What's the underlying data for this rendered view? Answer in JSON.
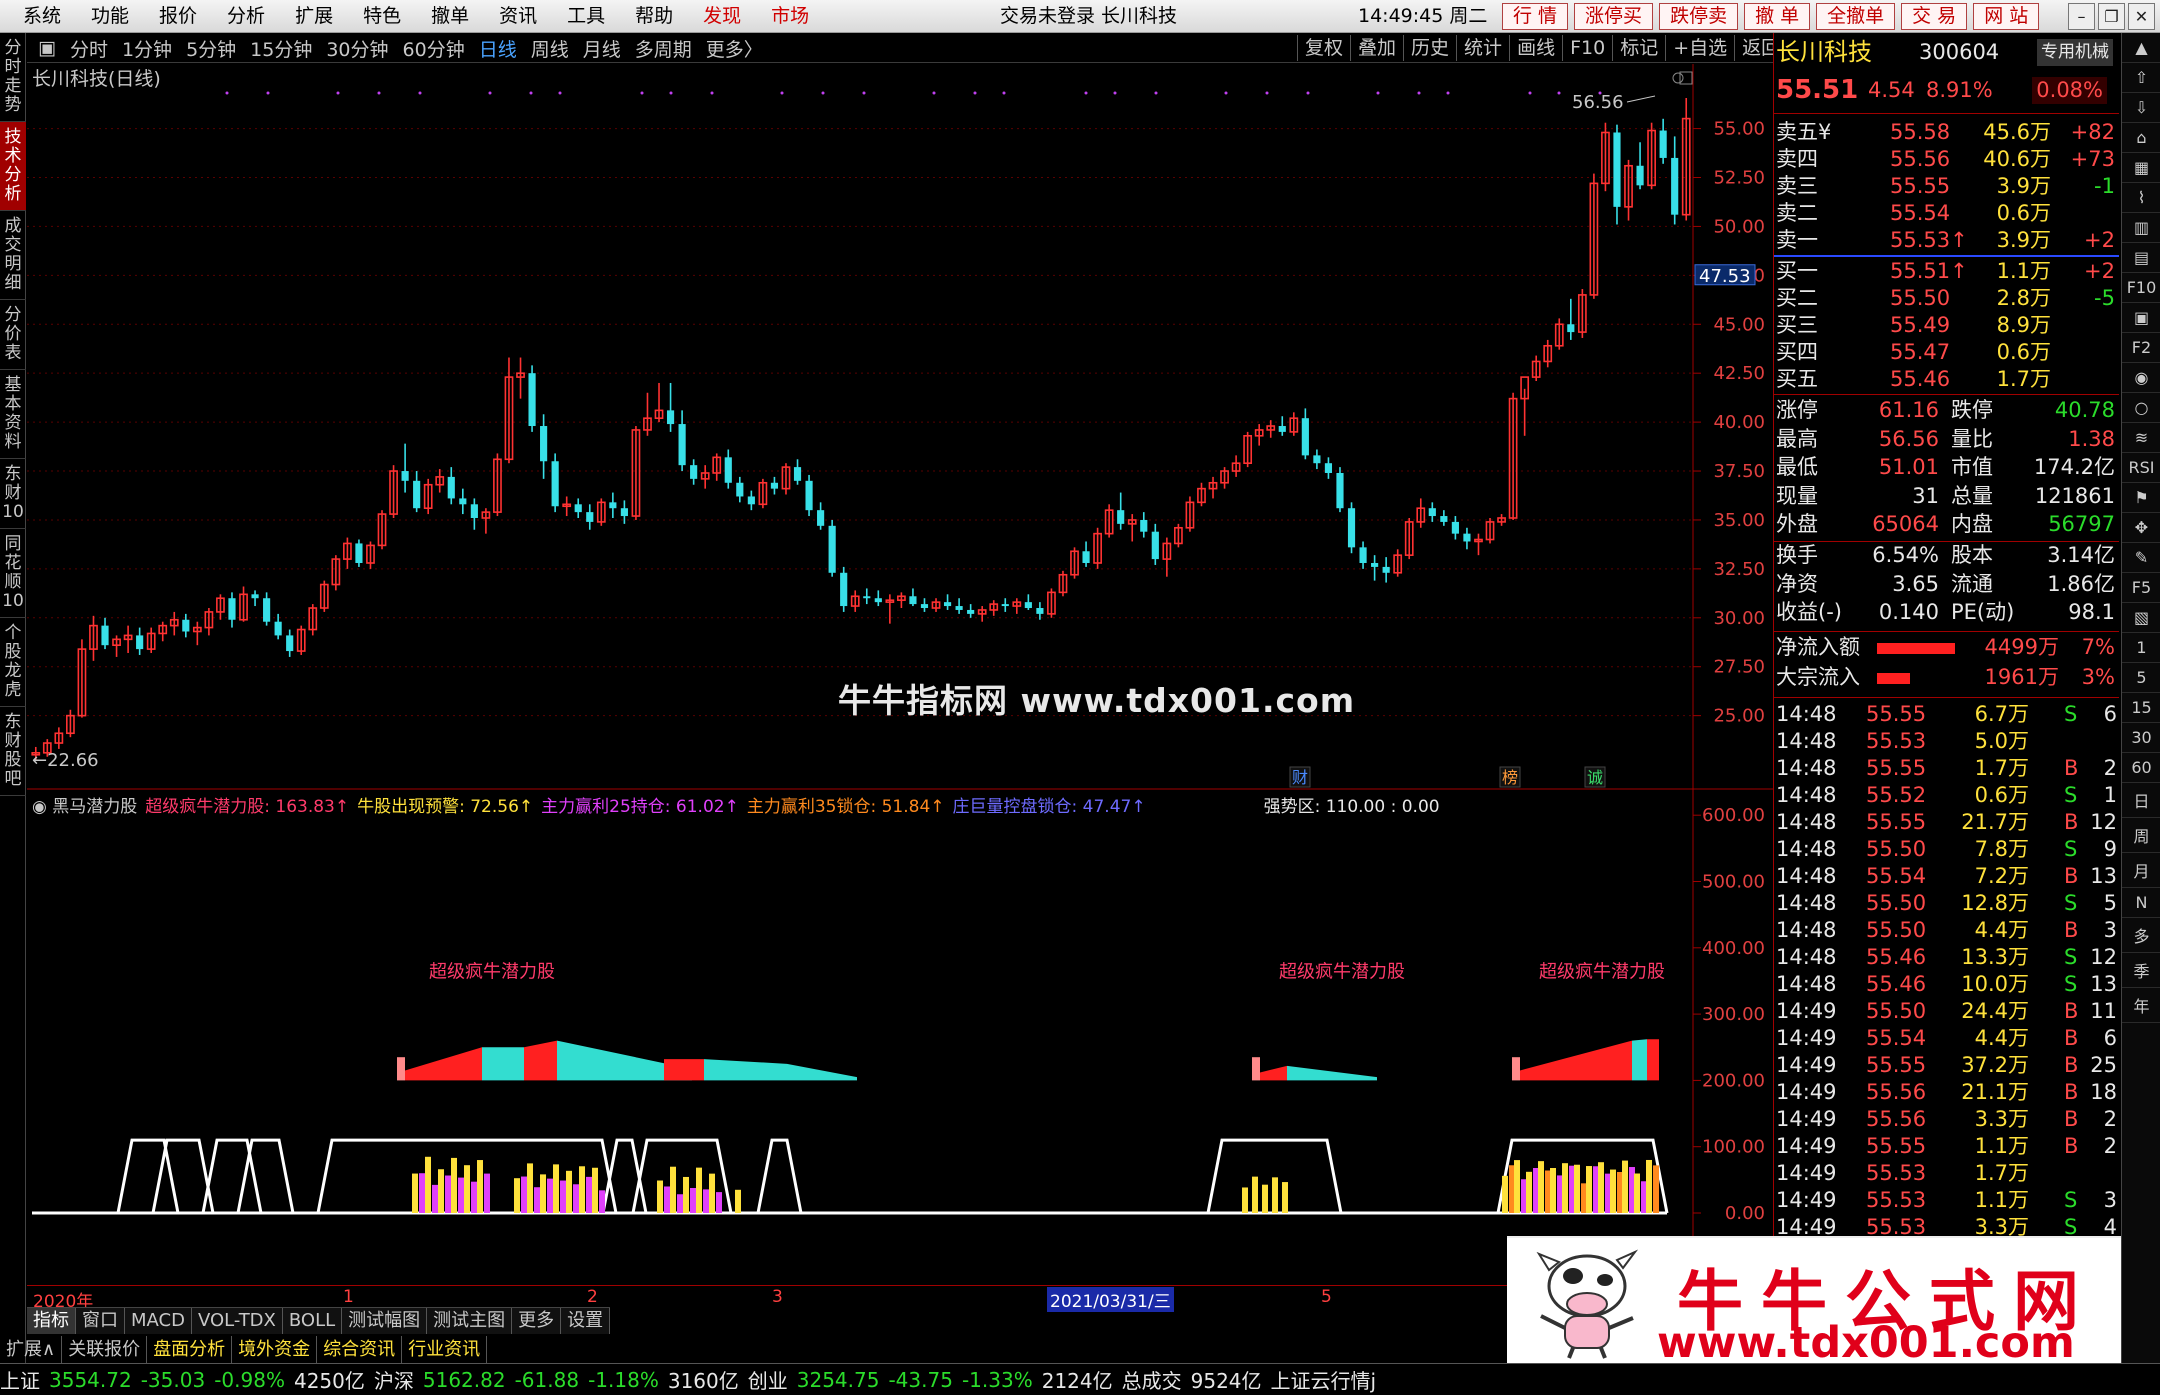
{
  "menubar": {
    "items": [
      "系统",
      "功能",
      "报价",
      "分析",
      "扩展",
      "特色",
      "撤单",
      "资讯",
      "工具",
      "帮助",
      "发现",
      "市场"
    ],
    "highlight": [
      "发现",
      "市场"
    ],
    "login_status": "交易未登录  长川科技",
    "clock": "14:49:45 周二",
    "quick_buttons": [
      "行 情",
      "涨停买",
      "跌停卖",
      "撤 单",
      "全撤单",
      "交 易",
      "网 站"
    ],
    "window_controls": [
      "–",
      "❐",
      "✕"
    ]
  },
  "sidebar": {
    "tabs": [
      "分时走势",
      "技术分析",
      "成交明细",
      "分价表",
      "基本资料",
      "东财10",
      "同花顺10",
      "个股龙虎",
      "东财股吧"
    ],
    "active": "技术分析"
  },
  "toolbar": {
    "period_tabs": [
      "分时",
      "1分钟",
      "5分钟",
      "15分钟",
      "30分钟",
      "60分钟",
      "日线",
      "周线",
      "月线",
      "多周期",
      "更多〉"
    ],
    "active": "日线",
    "right_tools": [
      "复权",
      "叠加",
      "历史",
      "统计",
      "画线",
      "F10",
      "标记",
      "+自选",
      "返回"
    ]
  },
  "chart": {
    "title": "长川科技(日线)",
    "high_label": "56.56",
    "low_label": "22.66",
    "current_label": "47.53",
    "price_ticks": [
      "55.00",
      "52.50",
      "50.00",
      "47.50",
      "45.00",
      "42.50",
      "40.00",
      "37.50",
      "35.00",
      "32.50",
      "30.00",
      "27.50",
      "25.00"
    ],
    "event_marks": [
      "财",
      "榜",
      "诚"
    ]
  },
  "chart_data": {
    "type": "candlestick",
    "x_start": "2020",
    "candles_ohlc": [
      [
        23.0,
        23.4,
        22.7,
        23.1
      ],
      [
        23.1,
        23.8,
        22.9,
        23.6
      ],
      [
        23.6,
        24.4,
        23.3,
        24.1
      ],
      [
        24.1,
        25.3,
        23.9,
        25.0
      ],
      [
        25.0,
        28.9,
        24.9,
        28.4
      ],
      [
        28.4,
        30.1,
        27.8,
        29.6
      ],
      [
        29.6,
        30.0,
        28.4,
        28.6
      ],
      [
        28.6,
        29.1,
        28.0,
        28.9
      ],
      [
        28.9,
        29.6,
        28.2,
        29.1
      ],
      [
        29.1,
        29.5,
        28.1,
        28.4
      ],
      [
        28.4,
        29.5,
        28.2,
        29.2
      ],
      [
        29.2,
        29.8,
        28.8,
        29.6
      ],
      [
        29.6,
        30.3,
        29.1,
        29.9
      ],
      [
        29.9,
        30.2,
        29.0,
        29.3
      ],
      [
        29.3,
        29.8,
        28.6,
        29.5
      ],
      [
        29.5,
        30.5,
        29.1,
        30.3
      ],
      [
        30.3,
        31.2,
        29.9,
        31.0
      ],
      [
        31.0,
        31.3,
        29.5,
        29.9
      ],
      [
        29.9,
        31.6,
        29.8,
        31.2
      ],
      [
        31.2,
        31.4,
        30.6,
        31.0
      ],
      [
        31.0,
        31.3,
        29.6,
        29.8
      ],
      [
        29.8,
        30.2,
        28.9,
        29.1
      ],
      [
        29.1,
        29.4,
        28.0,
        28.3
      ],
      [
        28.3,
        29.6,
        28.1,
        29.4
      ],
      [
        29.4,
        30.7,
        29.1,
        30.5
      ],
      [
        30.5,
        31.9,
        30.3,
        31.7
      ],
      [
        31.7,
        33.2,
        31.4,
        33.0
      ],
      [
        33.0,
        34.1,
        32.5,
        33.8
      ],
      [
        33.8,
        34.0,
        32.6,
        32.8
      ],
      [
        32.8,
        33.9,
        32.5,
        33.7
      ],
      [
        33.7,
        35.5,
        33.5,
        35.3
      ],
      [
        35.3,
        37.8,
        35.1,
        37.5
      ],
      [
        37.5,
        38.9,
        36.4,
        37.0
      ],
      [
        37.0,
        37.5,
        35.4,
        35.6
      ],
      [
        35.6,
        37.1,
        35.3,
        36.8
      ],
      [
        36.8,
        37.6,
        36.4,
        37.2
      ],
      [
        37.2,
        37.7,
        35.8,
        36.1
      ],
      [
        36.1,
        36.6,
        35.3,
        35.8
      ],
      [
        35.8,
        36.1,
        34.5,
        35.1
      ],
      [
        35.1,
        35.6,
        34.3,
        35.4
      ],
      [
        35.4,
        38.4,
        35.2,
        38.1
      ],
      [
        38.1,
        43.3,
        37.9,
        42.3
      ],
      [
        42.3,
        43.3,
        41.2,
        42.5
      ],
      [
        42.5,
        42.9,
        39.5,
        39.8
      ],
      [
        39.8,
        40.4,
        37.1,
        38.0
      ],
      [
        38.0,
        38.4,
        35.4,
        35.7
      ],
      [
        35.7,
        36.2,
        35.2,
        35.8
      ],
      [
        35.8,
        36.1,
        35.1,
        35.4
      ],
      [
        35.4,
        35.8,
        34.5,
        34.9
      ],
      [
        34.9,
        36.1,
        34.7,
        35.9
      ],
      [
        35.9,
        36.4,
        35.1,
        35.6
      ],
      [
        35.6,
        36.0,
        34.8,
        35.2
      ],
      [
        35.2,
        39.8,
        35.0,
        39.6
      ],
      [
        39.6,
        41.5,
        39.3,
        40.2
      ],
      [
        40.2,
        42.0,
        40.0,
        40.6
      ],
      [
        40.6,
        42.0,
        39.5,
        39.9
      ],
      [
        39.9,
        40.6,
        37.5,
        37.8
      ],
      [
        37.8,
        38.1,
        36.8,
        37.1
      ],
      [
        37.1,
        37.8,
        36.6,
        37.4
      ],
      [
        37.4,
        38.4,
        37.0,
        38.2
      ],
      [
        38.2,
        38.6,
        36.6,
        36.9
      ],
      [
        36.9,
        37.2,
        35.9,
        36.2
      ],
      [
        36.2,
        36.5,
        35.5,
        35.8
      ],
      [
        35.8,
        37.1,
        35.6,
        36.9
      ],
      [
        36.9,
        37.2,
        36.3,
        36.6
      ],
      [
        36.6,
        37.9,
        36.3,
        37.7
      ],
      [
        37.7,
        38.1,
        36.8,
        37.0
      ],
      [
        37.0,
        37.3,
        35.2,
        35.5
      ],
      [
        35.5,
        35.9,
        34.5,
        34.7
      ],
      [
        34.7,
        35.0,
        32.1,
        32.3
      ],
      [
        32.3,
        32.6,
        30.3,
        30.6
      ],
      [
        30.6,
        31.4,
        30.3,
        31.1
      ],
      [
        31.1,
        31.5,
        30.7,
        31.0
      ],
      [
        31.0,
        31.4,
        30.6,
        30.8
      ],
      [
        30.8,
        31.2,
        29.7,
        30.9
      ],
      [
        30.9,
        31.3,
        30.5,
        31.1
      ],
      [
        31.1,
        31.5,
        30.6,
        30.7
      ],
      [
        30.7,
        31.0,
        30.3,
        30.5
      ],
      [
        30.5,
        31.0,
        30.3,
        30.8
      ],
      [
        30.8,
        31.2,
        30.4,
        30.6
      ],
      [
        30.6,
        31.0,
        30.2,
        30.4
      ],
      [
        30.4,
        30.7,
        30.0,
        30.2
      ],
      [
        30.2,
        30.6,
        29.8,
        30.4
      ],
      [
        30.4,
        30.9,
        30.1,
        30.7
      ],
      [
        30.7,
        31.0,
        30.3,
        30.6
      ],
      [
        30.6,
        31.0,
        30.2,
        30.8
      ],
      [
        30.8,
        31.2,
        30.4,
        30.5
      ],
      [
        30.5,
        30.8,
        29.9,
        30.2
      ],
      [
        30.2,
        31.5,
        30.0,
        31.3
      ],
      [
        31.3,
        32.4,
        31.1,
        32.2
      ],
      [
        32.2,
        33.6,
        32.0,
        33.4
      ],
      [
        33.4,
        33.9,
        32.6,
        32.8
      ],
      [
        32.8,
        34.6,
        32.5,
        34.3
      ],
      [
        34.3,
        35.8,
        34.1,
        35.5
      ],
      [
        35.5,
        36.4,
        34.5,
        34.8
      ],
      [
        34.8,
        35.3,
        33.9,
        35.0
      ],
      [
        35.0,
        35.4,
        34.1,
        34.4
      ],
      [
        34.4,
        34.8,
        32.7,
        33.0
      ],
      [
        33.0,
        34.1,
        32.1,
        33.8
      ],
      [
        33.8,
        34.8,
        33.6,
        34.6
      ],
      [
        34.6,
        36.2,
        34.4,
        35.9
      ],
      [
        35.9,
        36.9,
        35.7,
        36.6
      ],
      [
        36.6,
        37.2,
        36.1,
        36.9
      ],
      [
        36.9,
        37.7,
        36.6,
        37.5
      ],
      [
        37.5,
        38.3,
        37.2,
        37.9
      ],
      [
        37.9,
        39.5,
        37.7,
        39.3
      ],
      [
        39.3,
        39.9,
        38.8,
        39.6
      ],
      [
        39.6,
        40.1,
        39.2,
        39.8
      ],
      [
        39.8,
        40.3,
        39.3,
        39.5
      ],
      [
        39.5,
        40.5,
        39.3,
        40.2
      ],
      [
        40.2,
        40.7,
        38.1,
        38.3
      ],
      [
        38.3,
        38.6,
        37.6,
        37.9
      ],
      [
        37.9,
        38.2,
        37.1,
        37.4
      ],
      [
        37.4,
        37.7,
        35.4,
        35.6
      ],
      [
        35.6,
        35.9,
        33.3,
        33.6
      ],
      [
        33.6,
        33.9,
        32.5,
        32.8
      ],
      [
        32.8,
        33.2,
        31.9,
        32.6
      ],
      [
        32.6,
        33.1,
        31.8,
        32.3
      ],
      [
        32.3,
        33.5,
        32.1,
        33.2
      ],
      [
        33.2,
        35.1,
        33.0,
        34.9
      ],
      [
        34.9,
        36.1,
        34.6,
        35.6
      ],
      [
        35.6,
        35.9,
        34.9,
        35.2
      ],
      [
        35.2,
        35.5,
        34.7,
        34.9
      ],
      [
        34.9,
        35.2,
        34.0,
        34.3
      ],
      [
        34.3,
        34.6,
        33.5,
        33.9
      ],
      [
        33.9,
        34.3,
        33.2,
        34.0
      ],
      [
        34.0,
        35.1,
        33.8,
        34.9
      ],
      [
        34.9,
        35.3,
        34.7,
        35.1
      ],
      [
        35.1,
        41.5,
        35.0,
        41.2
      ],
      [
        41.2,
        41.7,
        39.3,
        42.3
      ],
      [
        42.3,
        43.4,
        42.1,
        43.1
      ],
      [
        43.1,
        44.2,
        42.8,
        43.9
      ],
      [
        43.9,
        45.3,
        43.7,
        45.0
      ],
      [
        45.0,
        46.3,
        44.2,
        44.6
      ],
      [
        44.6,
        46.8,
        44.3,
        46.5
      ],
      [
        46.5,
        52.7,
        46.3,
        52.2
      ],
      [
        52.2,
        55.3,
        51.8,
        54.8
      ],
      [
        54.8,
        55.2,
        50.1,
        51.0
      ],
      [
        51.0,
        53.4,
        50.3,
        53.1
      ],
      [
        53.1,
        54.3,
        51.9,
        52.1
      ],
      [
        52.1,
        55.3,
        51.9,
        54.9
      ],
      [
        54.9,
        55.5,
        53.2,
        53.5
      ],
      [
        53.5,
        54.6,
        50.1,
        50.6
      ],
      [
        50.6,
        56.56,
        50.3,
        55.51
      ]
    ]
  },
  "indicator": {
    "name": "黑马潜力股",
    "legend": [
      {
        "label": "超级疯牛潜力股: 163.83",
        "color": "#ff3b6b"
      },
      {
        "label": "牛股出现预警: 72.56",
        "color": "#ffe13c"
      },
      {
        "label": "主力赢利25持仓: 61.02",
        "color": "#e040fb"
      },
      {
        "label": "主力赢利35锁仓: 51.84",
        "color": "#ff8a1e"
      },
      {
        "label": "庄巨量控盘锁仓: 47.47",
        "color": "#6e6bff"
      }
    ],
    "strong_zone": "强势区: 110.00 : 0.00",
    "ticks": [
      "600.00",
      "500.00",
      "400.00",
      "300.00",
      "200.00",
      "100.00",
      "0.00"
    ],
    "signal_label": "超级疯牛潜力股"
  },
  "watermark": "牛牛指标网 www.tdx001.com",
  "timeaxis": {
    "labels": [
      "2020年",
      "1",
      "2",
      "3",
      "2021/03/31/三",
      "5"
    ]
  },
  "bottom_tabs": [
    "指标",
    "窗口",
    "MACD",
    "VOL-TDX",
    "BOLL",
    "测试幅图",
    "测试主图",
    "更多",
    "设置"
  ],
  "func_tabs": [
    "扩展∧",
    "关联报价",
    "盘面分析",
    "境外资金",
    "综合资讯",
    "行业资讯"
  ],
  "statusbar": {
    "items": [
      {
        "label": "上证",
        "c": "white"
      },
      {
        "label": "3554.72",
        "c": "green"
      },
      {
        "label": "-35.03",
        "c": "green"
      },
      {
        "label": "-0.98%",
        "c": "green"
      },
      {
        "label": "4250亿",
        "c": "white"
      },
      {
        "label": "沪深",
        "c": "white"
      },
      {
        "label": "5162.82",
        "c": "green"
      },
      {
        "label": "-61.88",
        "c": "green"
      },
      {
        "label": "-1.18%",
        "c": "green"
      },
      {
        "label": "3160亿",
        "c": "white"
      },
      {
        "label": "创业",
        "c": "white"
      },
      {
        "label": "3254.75",
        "c": "green"
      },
      {
        "label": "-43.75",
        "c": "green"
      },
      {
        "label": "-1.33%",
        "c": "green"
      },
      {
        "label": "2124亿",
        "c": "white"
      },
      {
        "label": "总成交",
        "c": "white"
      },
      {
        "label": "9524亿",
        "c": "white"
      },
      {
        "label": "上证云行情j",
        "c": "white"
      }
    ]
  },
  "stock": {
    "name": "长川科技",
    "code": "300604",
    "tag": "专用机械",
    "price": "55.51",
    "change": "4.54",
    "pct": "8.91%",
    "pct2": "0.08%"
  },
  "order_book": {
    "asks": [
      {
        "label": "卖五¥",
        "price": "55.58",
        "vol": "45.6万",
        "chg": "+82"
      },
      {
        "label": "卖四",
        "price": "55.56",
        "vol": "40.6万",
        "chg": "+73"
      },
      {
        "label": "卖三",
        "price": "55.55",
        "vol": "3.9万",
        "chg": "-1"
      },
      {
        "label": "卖二",
        "price": "55.54",
        "vol": "0.6万",
        "chg": ""
      },
      {
        "label": "卖一",
        "price": "55.53↑",
        "vol": "3.9万",
        "chg": "+2"
      }
    ],
    "bids": [
      {
        "label": "买一",
        "price": "55.51↑",
        "vol": "1.1万",
        "chg": "+2"
      },
      {
        "label": "买二",
        "price": "55.50",
        "vol": "2.8万",
        "chg": "-5"
      },
      {
        "label": "买三",
        "price": "55.49",
        "vol": "8.9万",
        "chg": ""
      },
      {
        "label": "买四",
        "price": "55.47",
        "vol": "0.6万",
        "chg": ""
      },
      {
        "label": "买五",
        "price": "55.46",
        "vol": "1.7万",
        "chg": ""
      }
    ]
  },
  "stats": [
    {
      "k1": "涨停",
      "v1": "61.16",
      "c1": "red",
      "k2": "跌停",
      "v2": "40.78",
      "c2": "green"
    },
    {
      "k1": "最高",
      "v1": "56.56",
      "c1": "red",
      "k2": "量比",
      "v2": "1.38",
      "c2": "red"
    },
    {
      "k1": "最低",
      "v1": "51.01",
      "c1": "red",
      "k2": "市值",
      "v2": "174.2亿",
      "c2": "white"
    },
    {
      "k1": "现量",
      "v1": "31",
      "c1": "white",
      "k2": "总量",
      "v2": "121861",
      "c2": "white"
    },
    {
      "k1": "外盘",
      "v1": "65064",
      "c1": "red",
      "k2": "内盘",
      "v2": "56797",
      "c2": "green"
    },
    {
      "k1": "换手",
      "v1": "6.54%",
      "c1": "white",
      "k2": "股本",
      "v2": "3.14亿",
      "c2": "white"
    },
    {
      "k1": "净资",
      "v1": "3.65",
      "c1": "white",
      "k2": "流通",
      "v2": "1.86亿",
      "c2": "white"
    },
    {
      "k1": "收益(-)",
      "v1": "0.140",
      "c1": "white",
      "k2": "PE(动)",
      "v2": "98.1",
      "c2": "white"
    }
  ],
  "flows": [
    {
      "label": "净流入额",
      "value": "4499万",
      "pct": "7%",
      "bar": 0.95
    },
    {
      "label": "大宗流入",
      "value": "1961万",
      "pct": "3%",
      "bar": 0.4
    }
  ],
  "ticks_list": [
    [
      "14:48",
      "55.55",
      "6.7万",
      "S",
      "6"
    ],
    [
      "14:48",
      "55.53",
      "5.0万",
      "",
      ""
    ],
    [
      "14:48",
      "55.55",
      "1.7万",
      "B",
      "2"
    ],
    [
      "14:48",
      "55.52",
      "0.6万",
      "S",
      "1"
    ],
    [
      "14:48",
      "55.55",
      "21.7万",
      "B",
      "12"
    ],
    [
      "14:48",
      "55.50",
      "7.8万",
      "S",
      "9"
    ],
    [
      "14:48",
      "55.54",
      "7.2万",
      "B",
      "13"
    ],
    [
      "14:48",
      "55.50",
      "12.8万",
      "S",
      "5"
    ],
    [
      "14:48",
      "55.50",
      "4.4万",
      "B",
      "3"
    ],
    [
      "14:48",
      "55.46",
      "13.3万",
      "S",
      "12"
    ],
    [
      "14:48",
      "55.46",
      "10.0万",
      "S",
      "13"
    ],
    [
      "14:49",
      "55.50",
      "24.4万",
      "B",
      "11"
    ],
    [
      "14:49",
      "55.54",
      "4.4万",
      "B",
      "6"
    ],
    [
      "14:49",
      "55.55",
      "37.2万",
      "B",
      "25"
    ],
    [
      "14:49",
      "55.56",
      "21.1万",
      "B",
      "18"
    ],
    [
      "14:49",
      "55.56",
      "3.3万",
      "B",
      "2"
    ],
    [
      "14:49",
      "55.55",
      "1.1万",
      "B",
      "2"
    ],
    [
      "14:49",
      "55.53",
      "1.7万",
      "",
      ""
    ],
    [
      "14:49",
      "55.53",
      "1.1万",
      "S",
      "3"
    ],
    [
      "14:49",
      "55.53",
      "3.3万",
      "S",
      "4"
    ]
  ],
  "right_strip": [
    "▲",
    "⇧",
    "⇩",
    "⌂",
    "▦",
    "⌇",
    "▥",
    "▤",
    "F10",
    "▣",
    "F2",
    "◉",
    "○",
    "≋",
    "RSI",
    "⚑",
    "✥",
    "✎",
    "F5",
    "▧",
    "1",
    "5",
    "15",
    "30",
    "60",
    "日",
    "周",
    "月",
    "N",
    "多",
    "季",
    "年"
  ],
  "ad": {
    "title": "牛牛公式网",
    "url": "www.tdx001.com"
  }
}
